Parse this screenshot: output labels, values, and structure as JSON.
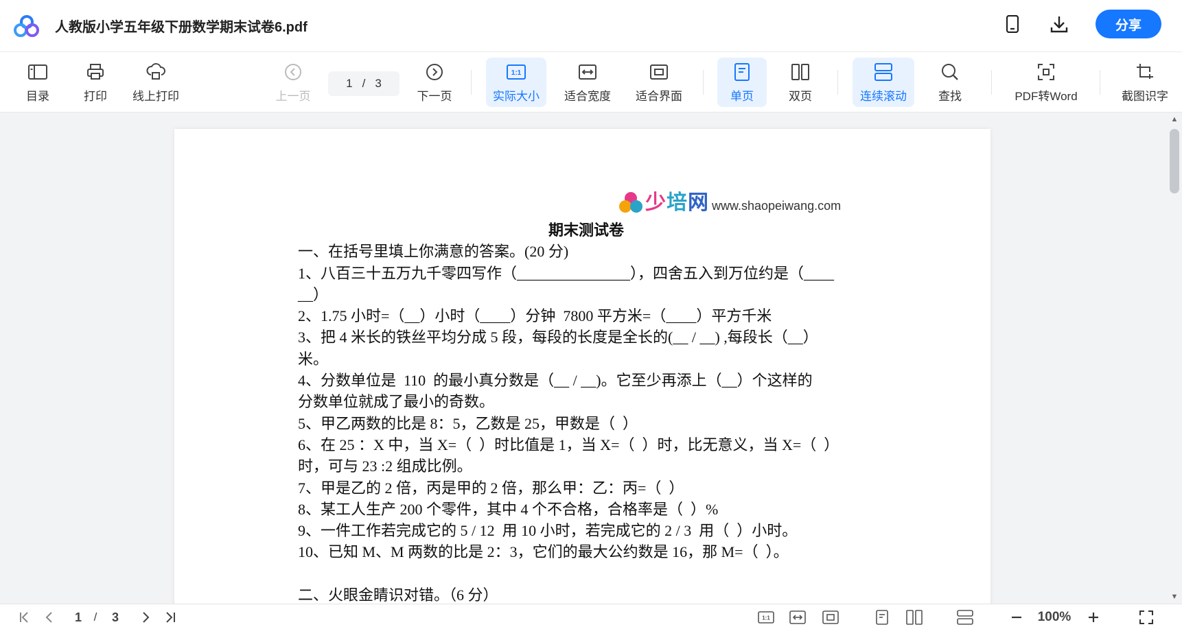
{
  "titlebar": {
    "title": "人教版小学五年级下册数学期末试卷6.pdf",
    "share_label": "分享",
    "icons": [
      "baidu-netdisk-logo-icon",
      "phone-icon",
      "download-icon"
    ]
  },
  "toolbar": {
    "toc_label": "目录",
    "print_label": "打印",
    "online_print_label": "线上打印",
    "prev_label": "上一页",
    "next_label": "下一页",
    "current_page": "1",
    "page_sep": "/",
    "total_pages": "3",
    "actual_size_label": "实际大小",
    "fit_width_label": "适合宽度",
    "fit_page_label": "适合界面",
    "single_page_label": "单页",
    "double_page_label": "双页",
    "continuous_label": "连续滚动",
    "find_label": "查找",
    "pdf_to_word_label": "PDF转Word",
    "ocr_label": "截图识字",
    "actual_size_glyph": "1:1"
  },
  "document": {
    "brand_name_part1": "少",
    "brand_name_part2": "培",
    "brand_name_part3": "网",
    "brand_url": "www.shaopeiwang.com",
    "heading": "期末测试卷",
    "lines": [
      "一、在括号里填上你满意的答案。(20 分)",
      "1、八百三十五万九千零四写作（_______________），四舍五入到万位约是（____",
      "__）",
      "2、1.75 小时=（__）小时（____）分钟  7800 平方米=（____）平方千米",
      "3、把 4 米长的铁丝平均分成 5 段，每段的长度是全长的(__ / __) ,每段长（__）",
      "米。",
      "4、分数单位是  110  的最小真分数是（__ / __)。它至少再添上（__）个这样的",
      "分数单位就成了最小的奇数。",
      "5、甲乙两数的比是 8：5，乙数是 25，甲数是（  ）",
      "6、在 25 ：X 中，当 X=（  ）时比值是 1，当 X=（  ）时，比无意义，当 X=（  ）",
      "时，可与 23 :2 组成比例。",
      "7、甲是乙的 2 倍，丙是甲的 2 倍，那么甲：乙：丙=（  ）",
      "8、某工人生产 200 个零件，其中 4 个不合格，合格率是（  ）%",
      "9、一件工作若完成它的 5 / 12  用 10 小时，若完成它的 2 / 3  用（  ）小时。",
      "10、已知 M、M 两数的比是 2：3，它们的最大公约数是 16，那 M=（  ）。",
      "",
      "二、火眼金睛识对错。（6 分）"
    ]
  },
  "statusbar": {
    "current_page": "1",
    "page_sep": "/",
    "total_pages": "3",
    "zoom": "100%",
    "actual_size_glyph": "1:1"
  },
  "colors": {
    "accent": "#1677ff",
    "active_bg": "#e8f2ff"
  }
}
